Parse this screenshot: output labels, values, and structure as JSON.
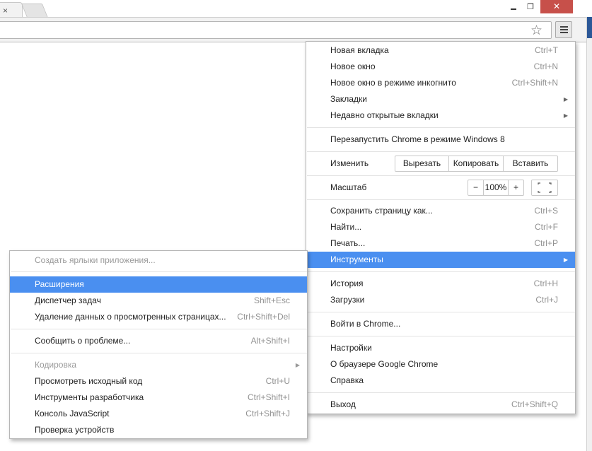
{
  "window": {
    "tab_close": "×",
    "minimize": "",
    "restore": "❐",
    "close": "✕"
  },
  "toolbar": {
    "bookmark_star": "☆"
  },
  "main_menu": {
    "new_tab": {
      "label": "Новая вкладка",
      "shortcut": "Ctrl+T"
    },
    "new_window": {
      "label": "Новое окно",
      "shortcut": "Ctrl+N"
    },
    "incognito": {
      "label": "Новое окно в режиме инкогнито",
      "shortcut": "Ctrl+Shift+N"
    },
    "bookmarks": {
      "label": "Закладки",
      "arrow": "▶"
    },
    "recent_tabs": {
      "label": "Недавно открытые вкладки",
      "arrow": "▶"
    },
    "relaunch": {
      "label": "Перезапустить Chrome в режиме Windows 8"
    },
    "edit": {
      "label": "Изменить",
      "cut": "Вырезать",
      "copy": "Копировать",
      "paste": "Вставить"
    },
    "zoom": {
      "label": "Масштаб",
      "minus": "−",
      "value": "100%",
      "plus": "+"
    },
    "save_page": {
      "label": "Сохранить страницу как...",
      "shortcut": "Ctrl+S"
    },
    "find": {
      "label": "Найти...",
      "shortcut": "Ctrl+F"
    },
    "print": {
      "label": "Печать...",
      "shortcut": "Ctrl+P"
    },
    "tools": {
      "label": "Инструменты",
      "arrow": "▶"
    },
    "history": {
      "label": "История",
      "shortcut": "Ctrl+H"
    },
    "downloads": {
      "label": "Загрузки",
      "shortcut": "Ctrl+J"
    },
    "sign_in": {
      "label": "Войти в Chrome..."
    },
    "settings": {
      "label": "Настройки"
    },
    "about": {
      "label": "О браузере Google Chrome"
    },
    "help": {
      "label": "Справка"
    },
    "exit": {
      "label": "Выход",
      "shortcut": "Ctrl+Shift+Q"
    }
  },
  "tools_submenu": {
    "create_shortcuts": {
      "label": "Создать ярлыки приложения..."
    },
    "extensions": {
      "label": "Расширения"
    },
    "task_manager": {
      "label": "Диспетчер задач",
      "shortcut": "Shift+Esc"
    },
    "clear_data": {
      "label": "Удаление данных о просмотренных страницах...",
      "shortcut": "Ctrl+Shift+Del"
    },
    "report_issue": {
      "label": "Сообщить о проблеме...",
      "shortcut": "Alt+Shift+I"
    },
    "encoding": {
      "label": "Кодировка",
      "arrow": "▶"
    },
    "view_source": {
      "label": "Просмотреть исходный код",
      "shortcut": "Ctrl+U"
    },
    "devtools": {
      "label": "Инструменты разработчика",
      "shortcut": "Ctrl+Shift+I"
    },
    "js_console": {
      "label": "Консоль JavaScript",
      "shortcut": "Ctrl+Shift+J"
    },
    "inspect_devices": {
      "label": "Проверка устройств"
    }
  }
}
